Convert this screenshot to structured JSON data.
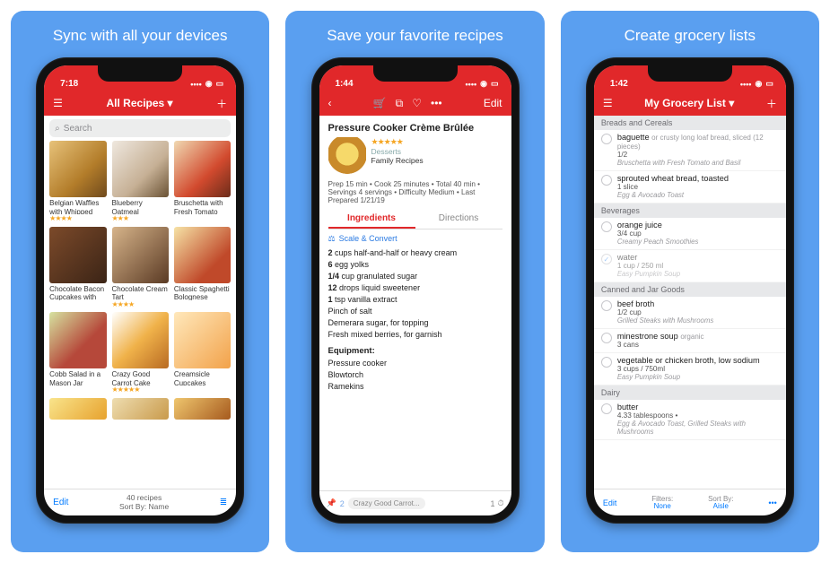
{
  "panels": {
    "p1": {
      "title": "Sync with all your devices"
    },
    "p2": {
      "title": "Save your favorite recipes"
    },
    "p3": {
      "title": "Create grocery lists"
    }
  },
  "s1": {
    "time": "7:18",
    "nav_title": "All Recipes ▾",
    "search_placeholder": "Search",
    "cards": [
      {
        "title": "Belgian Waffles with Whipped Cr...",
        "stars": "★★★★",
        "bg": "linear-gradient(135deg,#e7c27a,#b37d2a 60%,#6f4a1d)"
      },
      {
        "title": "Blueberry Oatmeal",
        "stars": "★★★",
        "bg": "linear-gradient(135deg,#efe8df,#c6b095 60%,#6a5234)"
      },
      {
        "title": "Bruschetta with Fresh Tomato an...",
        "stars": "",
        "bg": "linear-gradient(135deg,#f0d9b2,#d24a2e 60%,#6b2c1a)"
      },
      {
        "title": "Chocolate Bacon Cupcakes with M...",
        "stars": "",
        "bg": "linear-gradient(135deg,#7c4a2a,#3b2416)"
      },
      {
        "title": "Chocolate Cream Tart",
        "stars": "★★★★",
        "bg": "linear-gradient(135deg,#d7b48a,#5a3a24)"
      },
      {
        "title": "Classic Spaghetti Bolognese",
        "stars": "",
        "bg": "linear-gradient(135deg,#f6e3a6,#c0492a 70%)"
      },
      {
        "title": "Cobb Salad in a Mason Jar",
        "stars": "",
        "bg": "linear-gradient(135deg,#d6e3a0,#b6483a 60%)"
      },
      {
        "title": "Crazy Good Carrot Cake",
        "stars": "★★★★★",
        "bg": "linear-gradient(135deg,#fff,#f0b24a 50%,#b86a22)"
      },
      {
        "title": "Creamsicle Cupcakes",
        "stars": "",
        "bg": "linear-gradient(135deg,#ffe8bb,#f2a24a)"
      }
    ],
    "extra_row_bg": [
      "linear-gradient(135deg,#f9e48b,#e7a22e)",
      "linear-gradient(135deg,#eeddb0,#c99a4b)",
      "linear-gradient(135deg,#efc66e,#a65a1e)"
    ],
    "count": "40 recipes",
    "sort": "Sort By: Name",
    "edit": "Edit"
  },
  "s2": {
    "time": "1:44",
    "edit": "Edit",
    "title": "Pressure Cooker Crème Brûlée",
    "category": "Desserts",
    "source": "Family Recipes",
    "summary": "Prep 15 min • Cook 25 minutes • Total 40 min • Servings 4 servings • Difficulty Medium • Last Prepared 1/21/19",
    "tab_ing": "Ingredients",
    "tab_dir": "Directions",
    "scale": "Scale & Convert",
    "ingredients": [
      {
        "b": "2",
        "t": " cups half-and-half or heavy cream"
      },
      {
        "b": "6",
        "t": " egg yolks"
      },
      {
        "b": "1/4",
        "t": " cup granulated sugar"
      },
      {
        "b": "12",
        "t": " drops liquid sweetener"
      },
      {
        "b": "1",
        "t": " tsp vanilla extract"
      },
      {
        "b": "",
        "t": "Pinch of salt"
      },
      {
        "b": "",
        "t": "Demerara sugar, for topping"
      },
      {
        "b": "",
        "t": "Fresh mixed berries, for garnish"
      }
    ],
    "equip_h": "Equipment:",
    "equipment": [
      "Pressure cooker",
      "Blowtorch",
      "Ramekins"
    ],
    "prev_badge": "2",
    "prev_label": "Crazy Good Carrot...",
    "timer": "1"
  },
  "s3": {
    "time": "1:42",
    "nav_title": "My Grocery List ▾",
    "edit": "Edit",
    "filter_lab": "Filters:",
    "filter_val": "None",
    "sort_lab": "Sort By:",
    "sort_val": "Aisle",
    "sections": [
      {
        "h": "Breads and Cereals",
        "items": [
          {
            "t": "baguette",
            "n": "or crusty long loaf bread, sliced (12 pieces)",
            "q": "1/2",
            "r": "Bruschetta with Fresh Tomato and Basil",
            "chk": false
          },
          {
            "t": "sprouted wheat bread, toasted",
            "n": "",
            "q": "1 slice",
            "r": "Egg & Avocado Toast",
            "chk": false
          }
        ]
      },
      {
        "h": "Beverages",
        "items": [
          {
            "t": "orange juice",
            "n": "",
            "q": "3/4 cup",
            "r": "Creamy Peach Smoothies",
            "chk": false
          },
          {
            "t": "water",
            "n": "",
            "q": "1 cup / 250 ml",
            "r": "Easy Pumpkin Soup",
            "chk": true
          }
        ]
      },
      {
        "h": "Canned and Jar Goods",
        "items": [
          {
            "t": "beef broth",
            "n": "",
            "q": "1/2 cup",
            "r": "Grilled Steaks with Mushrooms",
            "chk": false
          },
          {
            "t": "minestrone soup",
            "n": "organic",
            "q": "3 cans",
            "r": "",
            "chk": false
          },
          {
            "t": "vegetable or chicken broth, low sodium",
            "n": "",
            "q": "3 cups / 750ml",
            "r": "Easy Pumpkin Soup",
            "chk": false
          }
        ]
      },
      {
        "h": "Dairy",
        "items": [
          {
            "t": "butter",
            "n": "",
            "q": "4.33 tablespoons •",
            "r": "Egg & Avocado Toast, Grilled Steaks with Mushrooms",
            "chk": false
          }
        ]
      }
    ]
  }
}
